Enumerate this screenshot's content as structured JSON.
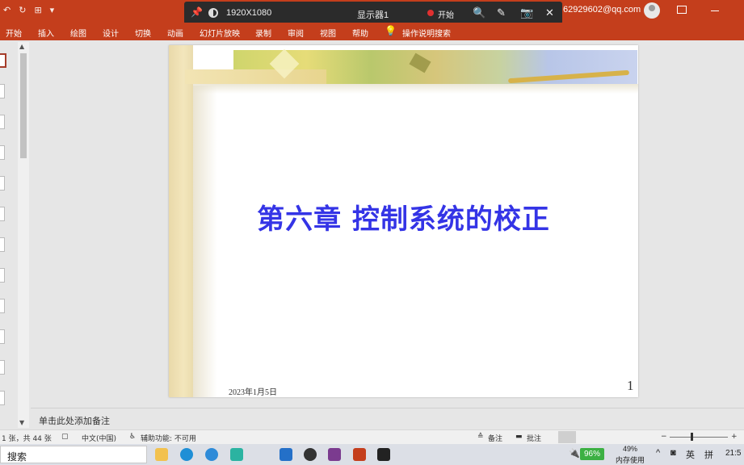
{
  "titlebar": {
    "account": "62929602@qq.com"
  },
  "recorder": {
    "resolution": "1920X1080",
    "monitor": "显示器1",
    "start_label": "开始"
  },
  "ribbon": {
    "tabs": [
      "开始",
      "插入",
      "绘图",
      "设计",
      "切换",
      "动画",
      "幻灯片放映",
      "录制",
      "审阅",
      "视图",
      "帮助"
    ],
    "search_label": "操作说明搜索"
  },
  "slide": {
    "title": "第六章  控制系统的校正",
    "date": "2023年1月5日",
    "number": "1"
  },
  "notes": {
    "placeholder": "单击此处添加备注"
  },
  "statusbar": {
    "slide_info": "1 张，共 44 张",
    "language": "中文(中国)",
    "accessibility": "辅助功能: 不可用",
    "notes_label": "备注",
    "comments_label": "批注"
  },
  "taskbar": {
    "search_label": "搜索",
    "battery_pct": "96%",
    "memory_pct": "49%",
    "memory_label": "内存使用",
    "ime": "英",
    "ime2": "拼",
    "clock": "21:5"
  },
  "colors": {
    "ribbon": "#c43e1c",
    "title_text": "#3434e6"
  }
}
